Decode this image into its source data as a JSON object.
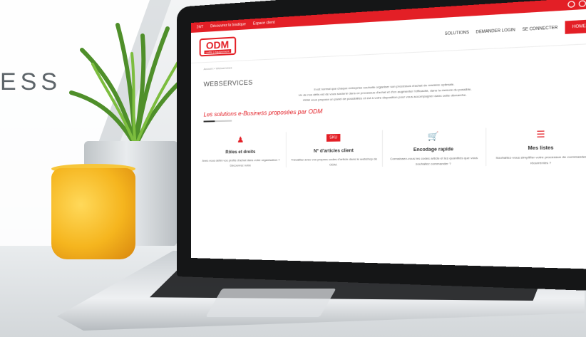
{
  "backdrop": {
    "text": "ESS"
  },
  "laptop": {
    "camera_label": "webcam"
  },
  "site": {
    "topbar": {
      "items": [
        "24/7",
        "Découvrez la boutique",
        "Espace client"
      ],
      "social": [
        "f",
        "in",
        "Y"
      ]
    },
    "logo": {
      "main": "ODM",
      "sub": "outils | équipement"
    },
    "nav": [
      "SOLUTIONS",
      "DEMANDER LOGIN",
      "SE CONNECTER",
      "HOME"
    ],
    "breadcrumb": "Accueil > Webservices",
    "title": "WEBSERVICES",
    "paragraphs": [
      "Il est normal que chaque entreprise souhaite organiser son processus d'achat de manière optimale.",
      "Un de nos défis est de vous soutenir dans ce processus d'achat et d'en augmenter l'efficacité, dans la mesure du possible.",
      "ODM vous propose un panel de possibilités et est à votre disposition pour vous accompagner dans cette démarche."
    ],
    "subtitle": "Les solutions e-Business proposées par ODM",
    "cards": [
      {
        "icon": "people-icon",
        "title": "Rôles et droits",
        "text": "Avez-vous défini vos profils d'achat dans votre organisation ? Découvrez notre"
      },
      {
        "icon": "sku-badge",
        "badge": "SKU",
        "title": "N° d'articles client",
        "text": "Travaillez avec vos propres codes d'article dans le webshop de ODM."
      },
      {
        "icon": "cart-icon",
        "title": "Encodage rapide",
        "text": "Connaissez-vous les codes article et les quantités que vous souhaitez commander ?"
      },
      {
        "icon": "list-icon",
        "title": "Mes listes",
        "text": "Souhaitez-vous simplifier votre processus de commandes récurrentes ?"
      }
    ]
  },
  "colors": {
    "brand_red": "#e31f26",
    "cup_yellow": "#f5b51e",
    "plant_green": "#4f8f2a"
  }
}
